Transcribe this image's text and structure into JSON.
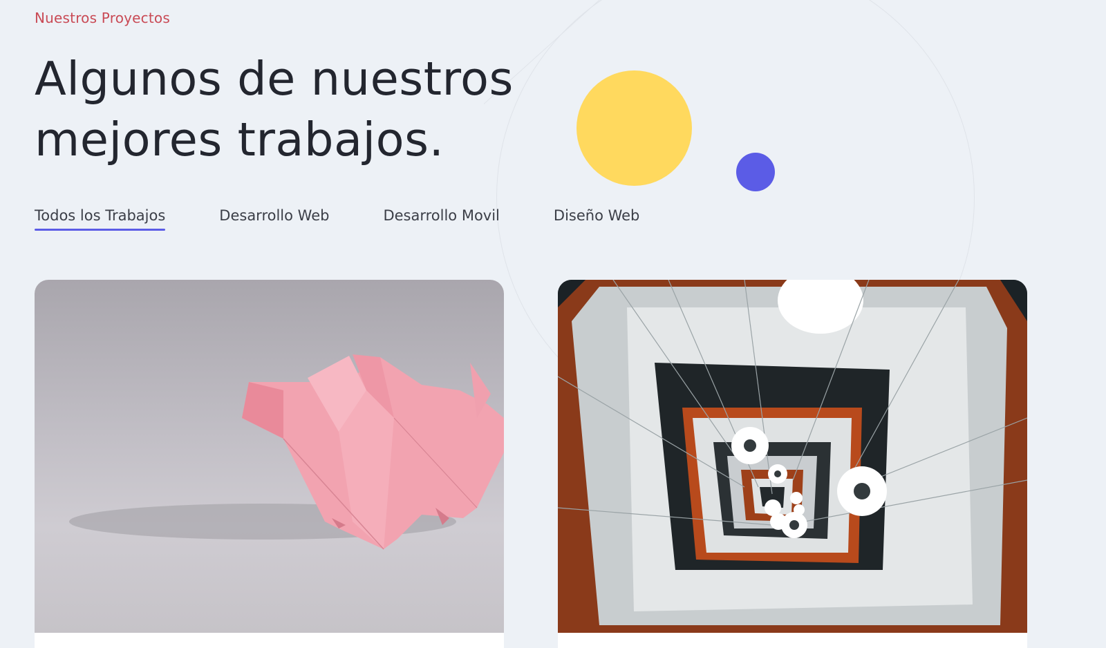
{
  "section": {
    "eyebrow": "Nuestros Proyectos",
    "heading_line_1": "Algunos de nuestros",
    "heading_line_2": "mejores trabajos."
  },
  "tabs": [
    {
      "label": "Todos los Trabajos",
      "active": true
    },
    {
      "label": "Desarrollo Web",
      "active": false
    },
    {
      "label": "Desarrollo Movil",
      "active": false
    },
    {
      "label": "Diseño Web",
      "active": false
    }
  ],
  "colors": {
    "accent": "#5b5ce6",
    "eyebrow": "#c94a55",
    "decor_yellow": "#ffd95e",
    "background": "#edf1f6"
  },
  "projects": [
    {
      "image": "origami-pig-photo"
    },
    {
      "image": "spiral-stairwell-photo"
    }
  ]
}
